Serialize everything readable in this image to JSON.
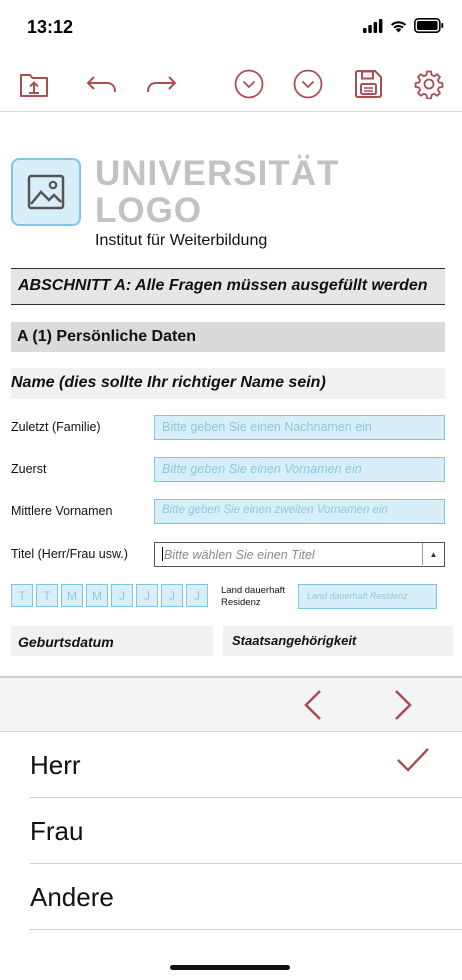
{
  "status_bar": {
    "time": "13:12"
  },
  "toolbar": {
    "icons": [
      "folder-upload-icon",
      "undo-icon",
      "redo-icon",
      "circle-chevron-down-icon",
      "circle-chevron-down-icon",
      "save-icon",
      "gear-icon"
    ],
    "accent_color": "#a84f55"
  },
  "form": {
    "logo": {
      "line1": "UNIVERSITÄT",
      "line2": "LOGO",
      "icon": "image-placeholder-icon"
    },
    "institute": "Institut für Weiterbildung",
    "section_a": "ABSCHNITT A: Alle Fragen müssen ausgefüllt werden",
    "subsection_a1": "A (1) Persönliche Daten",
    "name_question": "Name (dies sollte Ihr richtiger Name sein)",
    "fields": [
      {
        "label": "Zuletzt (Familie)",
        "placeholder": "Bitte geben Sie einen Nachnamen ein"
      },
      {
        "label": "Zuerst",
        "placeholder": "Bitte geben Sie einen Vornamen ein"
      },
      {
        "label": "Mittlere Vornamen",
        "placeholder": "Bitte geben Sie einen zweiten Vornamen ein"
      }
    ],
    "title_field": {
      "label": "Titel (Herr/Frau usw.)",
      "placeholder": "Bitte wählen Sie einen Titel",
      "caret": "▲"
    },
    "date_cells": [
      "T",
      "T",
      "M",
      "M",
      "J",
      "J",
      "J",
      "J"
    ],
    "residence": {
      "label_line1": "Land dauerhaft",
      "label_line2": "Residenz",
      "placeholder": "Land dauerhaft Residenz"
    },
    "birthdate_label": "Geburtsdatum",
    "nationality_label": "Staatsangehörigkeit",
    "field_color": "#d8eef8",
    "field_border_color": "#7fc6e3"
  },
  "picker": {
    "prev_icon": "chevron-left-icon",
    "next_icon": "chevron-right-icon",
    "options": [
      {
        "label": "Herr",
        "selected": true
      },
      {
        "label": "Frau",
        "selected": false
      },
      {
        "label": "Andere",
        "selected": false
      }
    ],
    "check_icon": "checkmark-icon"
  }
}
